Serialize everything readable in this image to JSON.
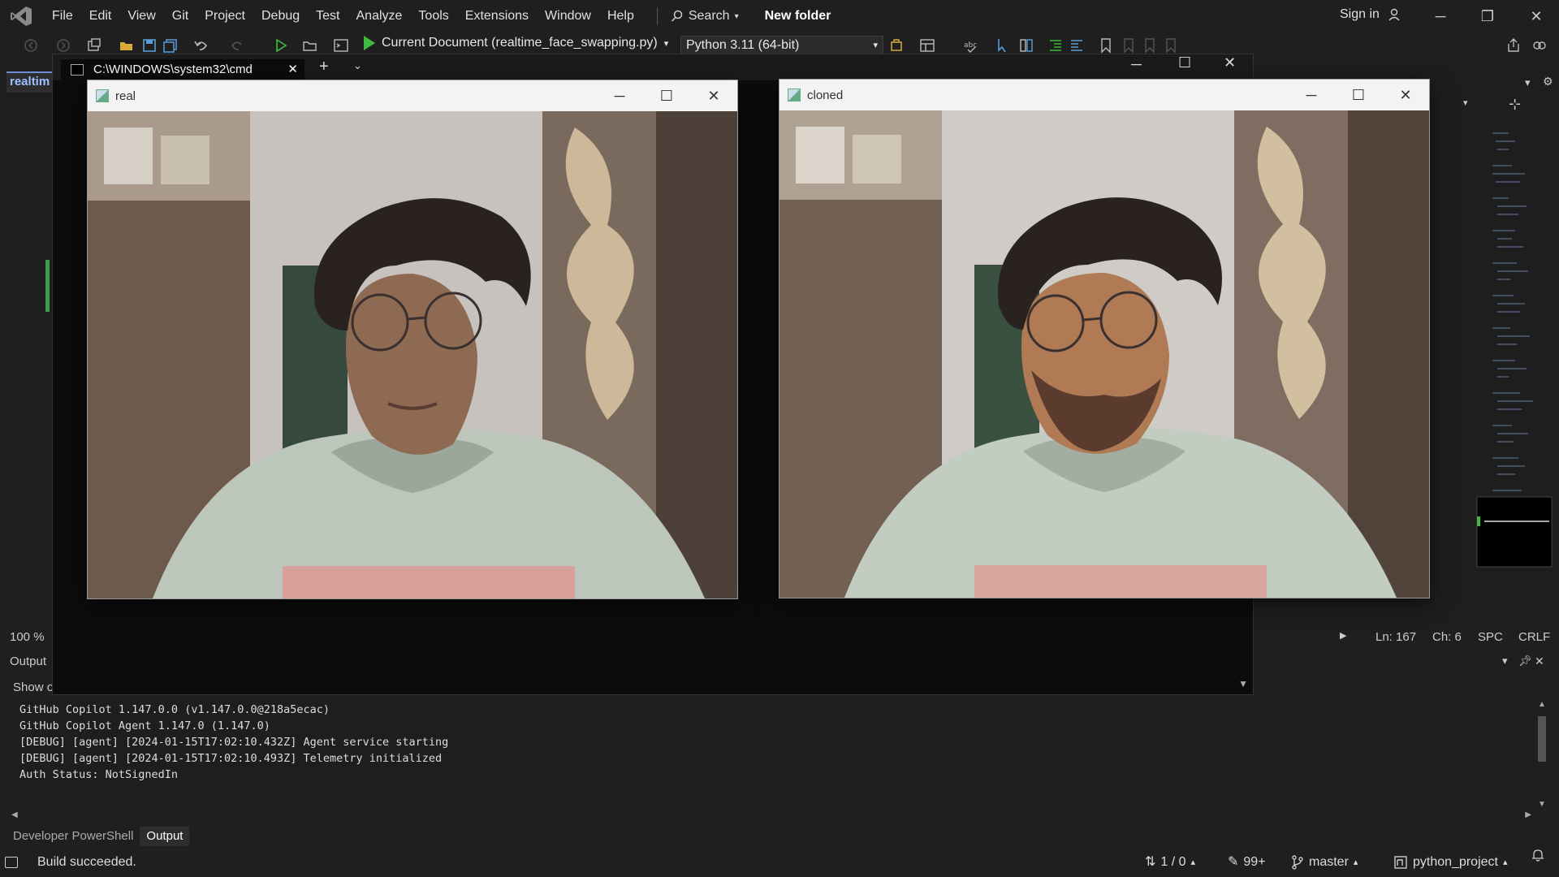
{
  "menubar": {
    "items": [
      "File",
      "Edit",
      "View",
      "Git",
      "Project",
      "Debug",
      "Test",
      "Analyze",
      "Tools",
      "Extensions",
      "Window",
      "Help"
    ],
    "search_label": "Search",
    "solution_name": "New folder",
    "signin_label": "Sign in"
  },
  "toolbar": {
    "run_target": "Current Document (realtime_face_swapping.py)",
    "python_env": "Python 3.11 (64-bit)"
  },
  "editor": {
    "doc_tab": "realtim",
    "zoom": "100 %",
    "line": "Ln: 167",
    "char": "Ch: 6",
    "spacing": "SPC",
    "line_ending": "CRLF"
  },
  "cmd": {
    "tab_title": "C:\\WINDOWS\\system32\\cmd"
  },
  "windows": {
    "real_title": "real",
    "cloned_title": "cloned"
  },
  "output": {
    "header": "Output",
    "show_label": "Show o",
    "lines": [
      "GitHub Copilot 1.147.0.0 (v1.147.0.0@218a5ecac)",
      "GitHub Copilot Agent 1.147.0 (1.147.0)",
      "[DEBUG] [agent] [2024-01-15T17:02:10.432Z] Agent service starting",
      "[DEBUG] [agent] [2024-01-15T17:02:10.493Z] Telemetry initialized",
      "Auth Status: NotSignedIn"
    ]
  },
  "bottom_tabs": [
    "Developer PowerShell",
    "Output"
  ],
  "statusbar": {
    "build": "Build succeeded.",
    "sync": "1 / 0",
    "edits": "99+",
    "branch": "master",
    "repo": "python_project"
  },
  "colors": {
    "accent": "#6f8cd9",
    "run_green": "#3fbb3f",
    "git_green": "#3f9c4f"
  }
}
